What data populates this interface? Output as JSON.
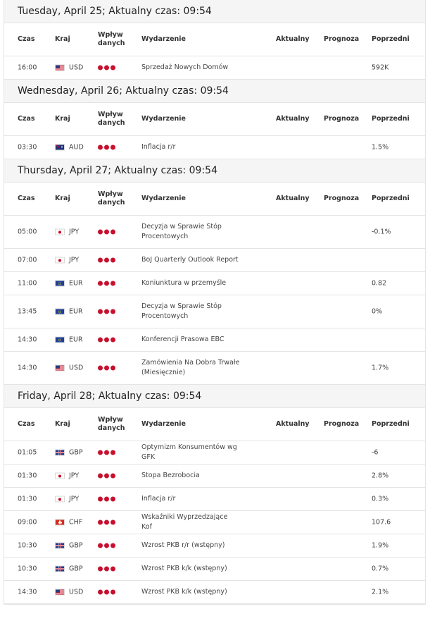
{
  "columns": {
    "time": "Czas",
    "country": "Kraj",
    "impact": "Wpływ danych",
    "event": "Wydarzenie",
    "actual": "Aktualny",
    "forecast": "Prognoza",
    "previous": "Poprzedni"
  },
  "colors": {
    "impact_dot": "#c8102e",
    "header_bg": "#f5f5f5",
    "border": "#e4e4e4"
  },
  "days": [
    {
      "title": "Tuesday, April 25; Aktualny czas: 09:54",
      "events": [
        {
          "time": "16:00",
          "flag": "us-flag-icon",
          "currency": "USD",
          "impact": 3,
          "event": "Sprzedaż Nowych Domów",
          "actual": "",
          "forecast": "",
          "previous": "592K",
          "tall": false
        }
      ]
    },
    {
      "title": "Wednesday, April 26; Aktualny czas: 09:54",
      "events": [
        {
          "time": "03:30",
          "flag": "au-flag-icon",
          "currency": "AUD",
          "impact": 3,
          "event": "Inflacja r/r",
          "actual": "",
          "forecast": "",
          "previous": "1.5%",
          "tall": false
        }
      ]
    },
    {
      "title": "Thursday, April 27; Aktualny czas: 09:54",
      "events": [
        {
          "time": "05:00",
          "flag": "jp-flag-icon",
          "currency": "JPY",
          "impact": 3,
          "event": "Decyzja w Sprawie Stóp Procentowych",
          "actual": "",
          "forecast": "",
          "previous": "-0.1%",
          "tall": true
        },
        {
          "time": "07:00",
          "flag": "jp-flag-icon",
          "currency": "JPY",
          "impact": 3,
          "event": "BoJ Quarterly Outlook Report",
          "actual": "",
          "forecast": "",
          "previous": "",
          "tall": false
        },
        {
          "time": "11:00",
          "flag": "eu-flag-icon",
          "currency": "EUR",
          "impact": 3,
          "event": "Koniunktura w przemyśle",
          "actual": "",
          "forecast": "",
          "previous": "0.82",
          "tall": false
        },
        {
          "time": "13:45",
          "flag": "eu-flag-icon",
          "currency": "EUR",
          "impact": 3,
          "event": "Decyzja w Sprawie Stóp Procentowych",
          "actual": "",
          "forecast": "",
          "previous": "0%",
          "tall": true
        },
        {
          "time": "14:30",
          "flag": "eu-flag-icon",
          "currency": "EUR",
          "impact": 3,
          "event": "Konferencji Prasowa EBC",
          "actual": "",
          "forecast": "",
          "previous": "",
          "tall": false
        },
        {
          "time": "14:30",
          "flag": "us-flag-icon",
          "currency": "USD",
          "impact": 3,
          "event": "Zamówienia Na Dobra Trwałe (Miesięcznie)",
          "actual": "",
          "forecast": "",
          "previous": "1.7%",
          "tall": true
        }
      ]
    },
    {
      "title": "Friday, April 28; Aktualny czas: 09:54",
      "events": [
        {
          "time": "01:05",
          "flag": "gb-flag-icon",
          "currency": "GBP",
          "impact": 3,
          "event": "Optymizm Konsumentów wg GFK",
          "actual": "",
          "forecast": "",
          "previous": "-6",
          "tall": false
        },
        {
          "time": "01:30",
          "flag": "jp-flag-icon",
          "currency": "JPY",
          "impact": 3,
          "event": "Stopa Bezrobocia",
          "actual": "",
          "forecast": "",
          "previous": "2.8%",
          "tall": false
        },
        {
          "time": "01:30",
          "flag": "jp-flag-icon",
          "currency": "JPY",
          "impact": 3,
          "event": "Inflacja r/r",
          "actual": "",
          "forecast": "",
          "previous": "0.3%",
          "tall": false
        },
        {
          "time": "09:00",
          "flag": "ch-flag-icon",
          "currency": "CHF",
          "impact": 3,
          "event": "Wskaźniki Wyprzedzające Kof",
          "actual": "",
          "forecast": "",
          "previous": "107.6",
          "tall": false
        },
        {
          "time": "10:30",
          "flag": "gb-flag-icon",
          "currency": "GBP",
          "impact": 3,
          "event": "Wzrost PKB r/r (wstępny)",
          "actual": "",
          "forecast": "",
          "previous": "1.9%",
          "tall": false
        },
        {
          "time": "10:30",
          "flag": "gb-flag-icon",
          "currency": "GBP",
          "impact": 3,
          "event": "Wzrost PKB k/k (wstępny)",
          "actual": "",
          "forecast": "",
          "previous": "0.7%",
          "tall": false
        },
        {
          "time": "14:30",
          "flag": "us-flag-icon",
          "currency": "USD",
          "impact": 3,
          "event": "Wzrost PKB k/k (wstępny)",
          "actual": "",
          "forecast": "",
          "previous": "2.1%",
          "tall": false
        }
      ]
    }
  ]
}
